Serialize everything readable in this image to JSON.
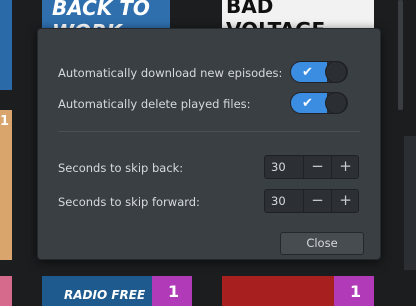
{
  "background": {
    "tile_top_left_text": "BACK TO WORK",
    "tile_top_right_text": "BAD VOLTAGE",
    "tile_bottom_left_text": "RADIO FREE",
    "badge_count": "1"
  },
  "dialog": {
    "auto_download_label": "Automatically download new episodes:",
    "auto_download_on": true,
    "auto_delete_label": "Automatically delete played files:",
    "auto_delete_on": true,
    "skip_back_label": "Seconds to skip back:",
    "skip_back_value": "30",
    "skip_forward_label": "Seconds to skip forward:",
    "skip_forward_value": "30",
    "minus_symbol": "−",
    "plus_symbol": "+",
    "close_label": "Close"
  },
  "colors": {
    "accent": "#3b8de2",
    "dialog_bg": "#3a3f44",
    "badge": "#b03ab8"
  }
}
